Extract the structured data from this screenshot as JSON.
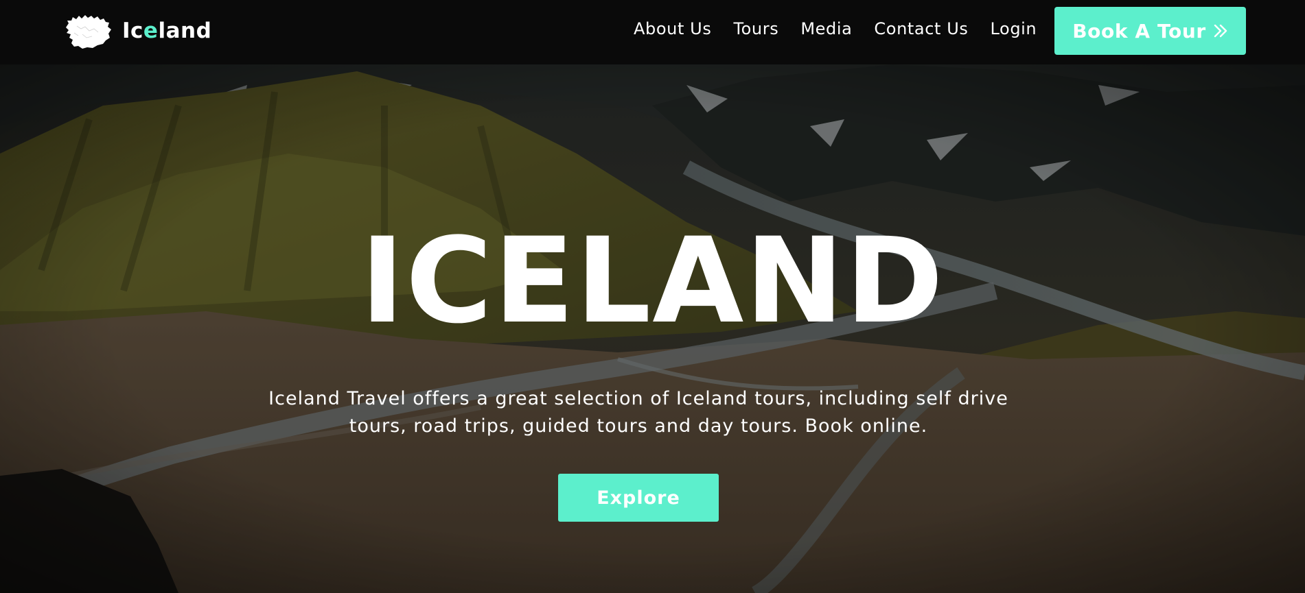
{
  "brand": {
    "logo_icon": "iceland-map-icon",
    "name_part1": "Ic",
    "name_part2": "e",
    "name_part3": "land"
  },
  "nav": {
    "links": [
      "About Us",
      "Tours",
      "Media",
      "Contact Us",
      "Login"
    ],
    "cta_label": "Book A Tour",
    "cta_icon": "double-chevron-right-icon"
  },
  "hero": {
    "title": "ICELAND",
    "description": "Iceland Travel offers a great selection of Iceland tours, including self drive tours, road trips, guided tours and day tours. Book online.",
    "button_label": "Explore",
    "background": "mountain-valley-river-photo"
  },
  "colors": {
    "accent": "#5cefcc",
    "navbar_bg": "#0a0a0a",
    "text": "#ffffff"
  }
}
